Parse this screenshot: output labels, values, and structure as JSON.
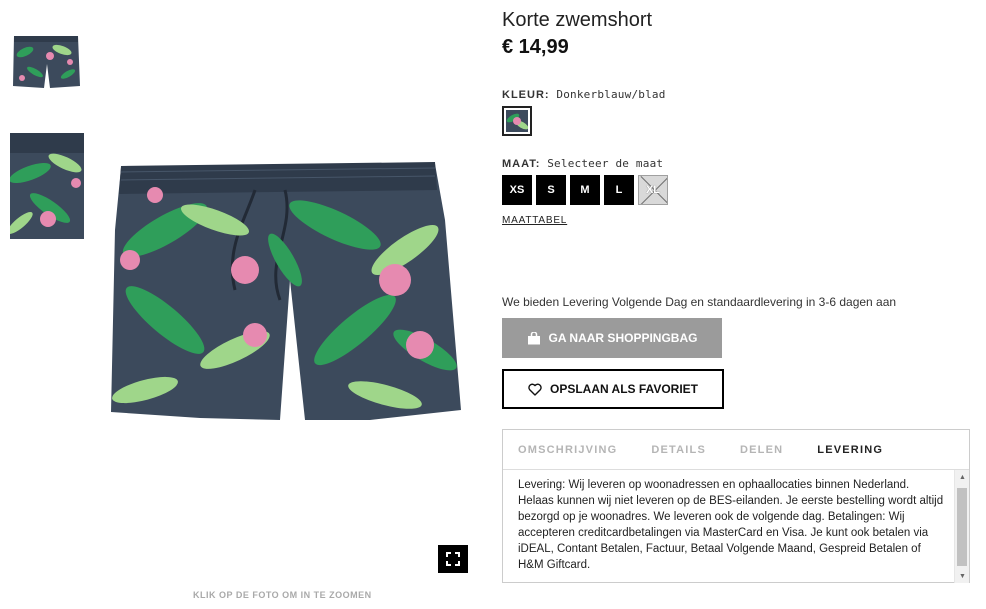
{
  "product": {
    "title": "Korte zwemshort",
    "price": "€ 14,99",
    "zoom_hint": "KLIK OP DE FOTO OM IN TE ZOOMEN"
  },
  "color": {
    "label": "KLEUR:",
    "value": "Donkerblauw/blad"
  },
  "size": {
    "label": "MAAT:",
    "value": "Selecteer de maat",
    "options": [
      "XS",
      "S",
      "M",
      "L",
      "XL"
    ],
    "unavailable": [
      "XL"
    ],
    "size_chart_link": "MAATTABEL"
  },
  "delivery_note": "We bieden Levering Volgende Dag en standaardlevering in 3-6 dagen aan",
  "buttons": {
    "bag": "GA NAAR SHOPPINGBAG",
    "favorite": "OPSLAAN ALS FAVORIET"
  },
  "tabs": {
    "items": [
      "OMSCHRIJVING",
      "DETAILS",
      "DELEN",
      "LEVERING"
    ],
    "active": "LEVERING",
    "content": "Levering: Wij leveren op woonadressen en ophaallocaties binnen Nederland. Helaas kunnen wij niet leveren op de BES-eilanden. Je eerste bestelling wordt altijd bezorgd op je woonadres. We leveren ook de volgende dag. Betalingen: Wij accepteren creditcardbetalingen via MasterCard en Visa. Je kunt ook betalen via iDEAL, Contant Betalen, Factuur, Betaal Volgende Maand, Gespreid Betalen of H&M Giftcard."
  },
  "colors": {
    "shorts_base": "#3c4a5c",
    "leaf_green": "#2f9e5a",
    "leaf_light": "#9fd68a",
    "flower_pink": "#e68ab0",
    "bag_button": "#9b9b9b"
  },
  "icons": {
    "zoom": "expand-icon",
    "bag": "shopping-bag-icon",
    "favorite": "heart-icon"
  }
}
